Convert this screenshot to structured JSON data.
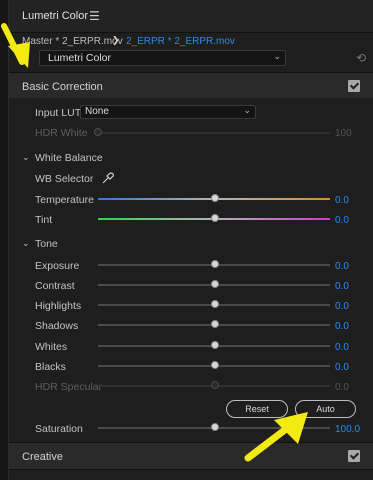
{
  "panel": {
    "title": "Lumetri Color",
    "menu_icon": "hamburger-icon"
  },
  "clip": {
    "master": "Master * 2_ERPR.mov",
    "active": "2_ERPR * 2_ERPR.mov"
  },
  "effect": {
    "fx_badge": "fx",
    "selected": "Lumetri Color",
    "reset_icon": "reset-icon"
  },
  "basic_correction": {
    "title": "Basic Correction",
    "enabled": true,
    "input_lut": {
      "label": "Input LUT",
      "value": "None"
    },
    "hdr_white": {
      "label": "HDR White",
      "value": "100"
    },
    "white_balance": {
      "title": "White Balance",
      "wb_selector": "WB Selector",
      "temperature": {
        "label": "Temperature",
        "value": "0.0"
      },
      "tint": {
        "label": "Tint",
        "value": "0.0"
      }
    },
    "tone": {
      "title": "Tone",
      "sliders": [
        {
          "label": "Exposure",
          "value": "0.0"
        },
        {
          "label": "Contrast",
          "value": "0.0"
        },
        {
          "label": "Highlights",
          "value": "0.0"
        },
        {
          "label": "Shadows",
          "value": "0.0"
        },
        {
          "label": "Whites",
          "value": "0.0"
        },
        {
          "label": "Blacks",
          "value": "0.0"
        },
        {
          "label": "HDR Specular",
          "value": "0.0"
        }
      ],
      "reset_label": "Reset",
      "auto_label": "Auto"
    },
    "saturation": {
      "label": "Saturation",
      "value": "100.0"
    }
  },
  "creative": {
    "title": "Creative",
    "enabled": true
  },
  "colors": {
    "accent_blue": "#2d8ceb",
    "annotation_yellow": "#f3ea12"
  }
}
